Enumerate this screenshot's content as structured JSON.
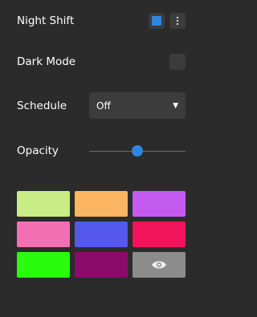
{
  "settings": {
    "night_shift": {
      "label": "Night Shift",
      "enabled": true,
      "accent": "#2f86e0"
    },
    "dark_mode": {
      "label": "Dark Mode",
      "enabled": false
    },
    "schedule": {
      "label": "Schedule",
      "value": "Off"
    },
    "opacity": {
      "label": "Opacity",
      "level": 0.5
    }
  },
  "swatches": [
    {
      "name": "light-green",
      "color": "#c8ec86"
    },
    {
      "name": "orange",
      "color": "#fdb562"
    },
    {
      "name": "purple",
      "color": "#c45bf0"
    },
    {
      "name": "pink",
      "color": "#f26fb3"
    },
    {
      "name": "blue",
      "color": "#5458ec"
    },
    {
      "name": "crimson",
      "color": "#f2135d"
    },
    {
      "name": "green",
      "color": "#29fc0c"
    },
    {
      "name": "magenta",
      "color": "#8d0a6d"
    },
    {
      "name": "eye-button",
      "color": "#8c8c8c",
      "icon": "eye-icon"
    }
  ],
  "colors": {
    "background": "#2b2b2b",
    "control": "#3c3c3c",
    "accent": "#2f86e0"
  }
}
